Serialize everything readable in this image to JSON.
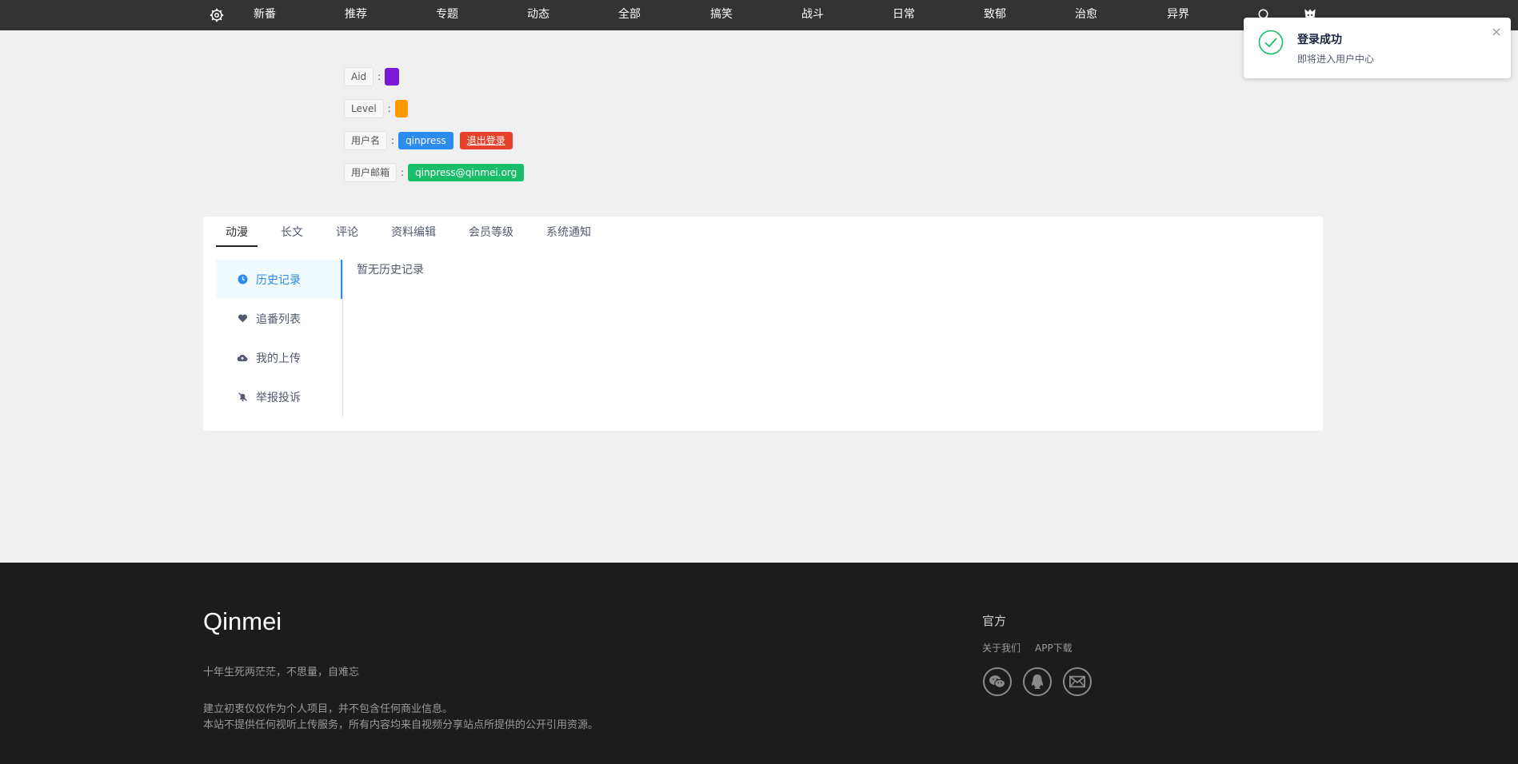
{
  "nav": {
    "items": [
      "新番",
      "推荐",
      "专题",
      "动态",
      "全部",
      "搞笑",
      "战斗",
      "日常",
      "致郁",
      "治愈",
      "异界"
    ],
    "logo_icon": "gear-icon",
    "search_icon": "search-icon",
    "avatar_icon": "avatar-icon"
  },
  "profile": {
    "aid_label": "Aid",
    "aid_color": "#7a18d6",
    "level_label": "Level",
    "level_color": "#ff9900",
    "username_label": "用户名",
    "username_value": "qinpress",
    "logout_label": "退出登录",
    "email_label": "用户邮箱",
    "email_value": "qinpress@qinmei.org",
    "separator": ":"
  },
  "tabs": [
    "动漫",
    "长文",
    "评论",
    "资料编辑",
    "会员等级",
    "系统通知"
  ],
  "active_tab": "动漫",
  "side_menu": [
    {
      "label": "历史记录",
      "icon": "clock-icon",
      "active": true
    },
    {
      "label": "追番列表",
      "icon": "heart-icon",
      "active": false
    },
    {
      "label": "我的上传",
      "icon": "cloud-upload-icon",
      "active": false
    },
    {
      "label": "举报投诉",
      "icon": "bell-off-icon",
      "active": false
    }
  ],
  "empty_text": "暂无历史记录",
  "footer": {
    "brand": "Qinmei",
    "slogan": "十年生死两茫茫，不思量，自难忘",
    "notice_lines": [
      "建立初衷仅仅作为个人项目，并不包含任何商业信息。",
      "本站不提供任何视听上传服务，所有内容均来自视频分享站点所提供的公开引用资源。"
    ],
    "official_title": "官方",
    "links": [
      "关于我们",
      "APP下载"
    ],
    "social_icons": [
      "wechat-icon",
      "qq-icon",
      "mail-icon"
    ]
  },
  "toast": {
    "title": "登录成功",
    "desc": "即将进入用户中心",
    "accent": "#19be6b"
  }
}
